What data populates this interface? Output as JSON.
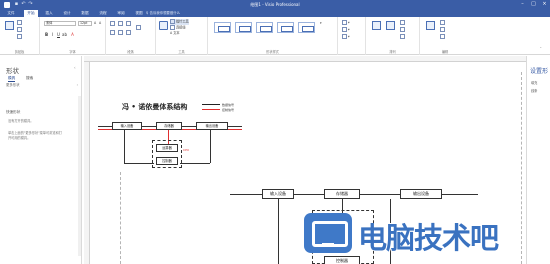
{
  "app": {
    "window_title": "绘图1 - Visio Professional"
  },
  "tabs": [
    {
      "label": "文件"
    },
    {
      "label": "开始"
    },
    {
      "label": "插入"
    },
    {
      "label": "设计"
    },
    {
      "label": "数据"
    },
    {
      "label": "流程"
    },
    {
      "label": "审阅"
    },
    {
      "label": "视图"
    }
  ],
  "tell_me": "告诉我你想要做什么",
  "ribbon": {
    "font_name": "宋体",
    "font_size": "12pt",
    "tools": {
      "pointer": "指针工具",
      "connector": "连接线",
      "text": "A 文本"
    },
    "group_labels": [
      "剪贴板",
      "字体",
      "段落",
      "工具",
      "形状样式",
      "排列",
      "编辑"
    ]
  },
  "shapes_panel": {
    "title": "形状",
    "tabs": [
      "模具",
      "搜索"
    ],
    "more_shapes": "更多形状",
    "section_heading": "快速形状",
    "hint_lines": [
      "没有打开的模具。",
      "",
      "单击上面的\"更多形状\"菜单可浏览和打",
      "开可用的模具。"
    ]
  },
  "diagram": {
    "title": "冯 • 诺依曼体系结构",
    "legend": [
      {
        "label": "数据信号",
        "color": "#222222"
      },
      {
        "label": "控制信号",
        "color": "#e02f2f"
      }
    ],
    "small": {
      "input": "输入设备",
      "memory": "存储器",
      "output": "输出设备",
      "alu": "运算器",
      "control": "控制器",
      "cpu": "CPU"
    },
    "large": {
      "input": "输入设备",
      "memory": "存储器",
      "output": "输出设备",
      "control": "控制器"
    }
  },
  "right_panel": {
    "title": "设置形",
    "items": [
      "填充",
      "线条"
    ]
  },
  "watermark": {
    "text": "电脑技术吧"
  },
  "colors": {
    "brand": "#3a5da6",
    "control_signal": "#e02f2f",
    "watermark": "#3a72c0"
  }
}
